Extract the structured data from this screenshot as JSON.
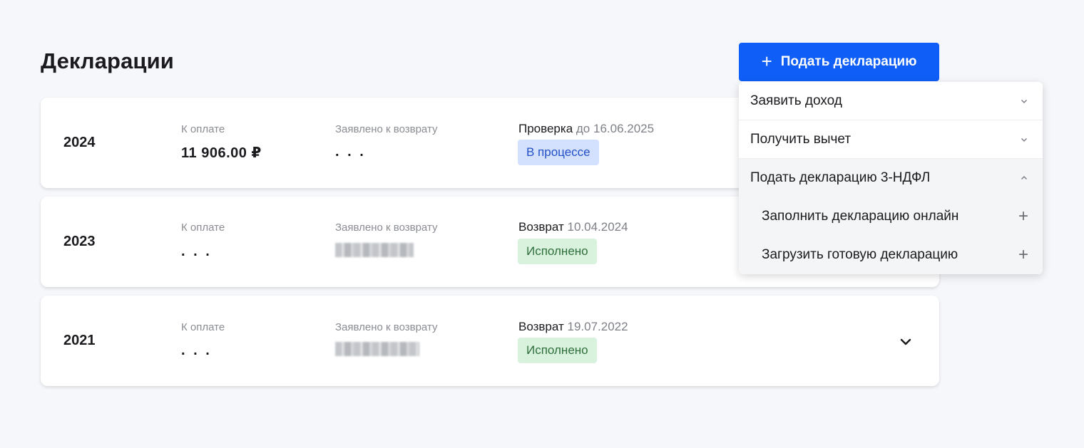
{
  "header": {
    "title": "Декларации",
    "submit_button": "Подать декларацию",
    "submit_button_icon": "plus-icon"
  },
  "columns": {
    "to_pay": "К оплате",
    "claimed_refund": "Заявлено к возврату"
  },
  "declarations": [
    {
      "year": "2024",
      "to_pay": "11 906.00 ₽",
      "claimed_refund": ". . .",
      "status_label": "Проверка",
      "status_date": "до 16.06.2025",
      "badge": "В процессе"
    },
    {
      "year": "2023",
      "to_pay": ". . .",
      "claimed_refund": "",
      "status_label": "Возврат",
      "status_date": "10.04.2024",
      "badge": "Исполнено"
    },
    {
      "year": "2021",
      "to_pay": ". . .",
      "claimed_refund": "",
      "status_label": "Возврат",
      "status_date": "19.07.2022",
      "badge": "Исполнено"
    }
  ],
  "dropdown": {
    "items": [
      {
        "label": "Заявить доход",
        "icon": "chevron-down-icon"
      },
      {
        "label": "Получить вычет",
        "icon": "chevron-down-icon"
      },
      {
        "label": "Подать декларацию 3-НДФЛ",
        "icon": "chevron-up-icon"
      }
    ],
    "subitems": [
      {
        "label": "Заполнить декларацию онлайн",
        "icon": "plus-icon"
      },
      {
        "label": "Загрузить готовую декларацию",
        "icon": "plus-icon"
      }
    ]
  },
  "colors": {
    "accent": "#0f5ef7",
    "badge_progress_bg": "#d3e1ff",
    "badge_done_bg": "#d9f2de"
  }
}
